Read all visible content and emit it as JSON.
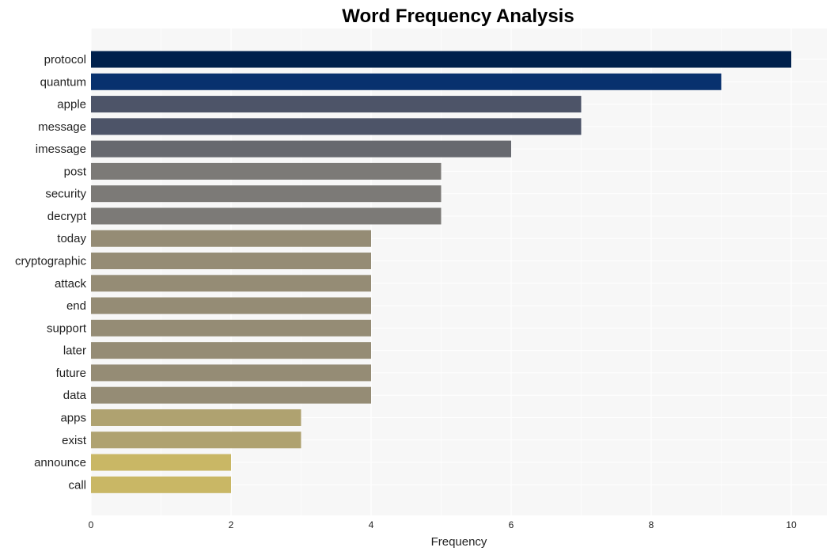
{
  "chart_data": {
    "type": "bar",
    "orientation": "horizontal",
    "title": "Word Frequency Analysis",
    "xlabel": "Frequency",
    "ylabel": "",
    "xlim": [
      0,
      10.5
    ],
    "xticks": [
      0,
      2,
      4,
      6,
      8,
      10
    ],
    "grid": true,
    "categories": [
      "protocol",
      "quantum",
      "apple",
      "message",
      "imessage",
      "post",
      "security",
      "decrypt",
      "today",
      "cryptographic",
      "attack",
      "end",
      "support",
      "later",
      "future",
      "data",
      "apps",
      "exist",
      "announce",
      "call"
    ],
    "values": [
      10,
      9,
      7,
      7,
      6,
      5,
      5,
      5,
      4,
      4,
      4,
      4,
      4,
      4,
      4,
      4,
      3,
      3,
      2,
      2
    ],
    "colors": [
      "#00204c",
      "#08316e",
      "#4d5468",
      "#4d5468",
      "#67696f",
      "#7c7a77",
      "#7c7a77",
      "#7c7a77",
      "#958c75",
      "#958c75",
      "#958c75",
      "#958c75",
      "#958c75",
      "#958c75",
      "#958c75",
      "#958c75",
      "#afa270",
      "#afa270",
      "#c9b765",
      "#c9b765"
    ]
  },
  "colors": {
    "plot_background": "#f7f7f7",
    "gridline": "#ffffff"
  }
}
